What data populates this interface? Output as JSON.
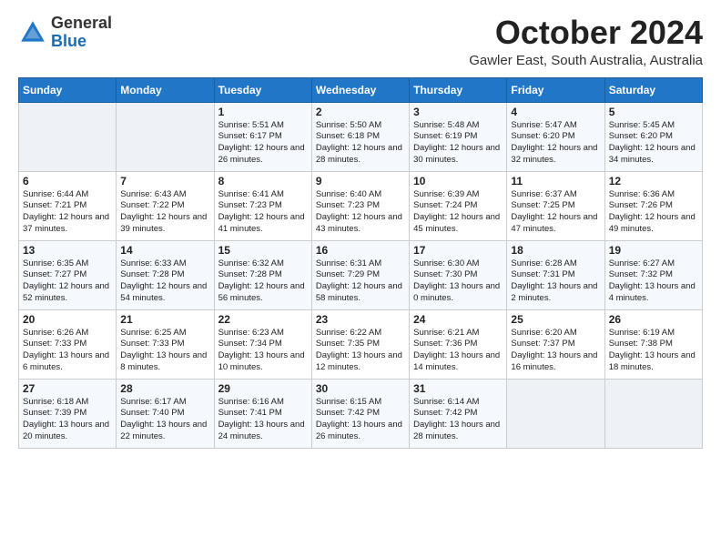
{
  "logo": {
    "general": "General",
    "blue": "Blue"
  },
  "header": {
    "month": "October 2024",
    "location": "Gawler East, South Australia, Australia"
  },
  "days_of_week": [
    "Sunday",
    "Monday",
    "Tuesday",
    "Wednesday",
    "Thursday",
    "Friday",
    "Saturday"
  ],
  "weeks": [
    [
      {
        "day": null
      },
      {
        "day": null
      },
      {
        "day": 1,
        "sunrise": "Sunrise: 5:51 AM",
        "sunset": "Sunset: 6:17 PM",
        "daylight": "Daylight: 12 hours and 26 minutes."
      },
      {
        "day": 2,
        "sunrise": "Sunrise: 5:50 AM",
        "sunset": "Sunset: 6:18 PM",
        "daylight": "Daylight: 12 hours and 28 minutes."
      },
      {
        "day": 3,
        "sunrise": "Sunrise: 5:48 AM",
        "sunset": "Sunset: 6:19 PM",
        "daylight": "Daylight: 12 hours and 30 minutes."
      },
      {
        "day": 4,
        "sunrise": "Sunrise: 5:47 AM",
        "sunset": "Sunset: 6:20 PM",
        "daylight": "Daylight: 12 hours and 32 minutes."
      },
      {
        "day": 5,
        "sunrise": "Sunrise: 5:45 AM",
        "sunset": "Sunset: 6:20 PM",
        "daylight": "Daylight: 12 hours and 34 minutes."
      }
    ],
    [
      {
        "day": 6,
        "sunrise": "Sunrise: 6:44 AM",
        "sunset": "Sunset: 7:21 PM",
        "daylight": "Daylight: 12 hours and 37 minutes."
      },
      {
        "day": 7,
        "sunrise": "Sunrise: 6:43 AM",
        "sunset": "Sunset: 7:22 PM",
        "daylight": "Daylight: 12 hours and 39 minutes."
      },
      {
        "day": 8,
        "sunrise": "Sunrise: 6:41 AM",
        "sunset": "Sunset: 7:23 PM",
        "daylight": "Daylight: 12 hours and 41 minutes."
      },
      {
        "day": 9,
        "sunrise": "Sunrise: 6:40 AM",
        "sunset": "Sunset: 7:23 PM",
        "daylight": "Daylight: 12 hours and 43 minutes."
      },
      {
        "day": 10,
        "sunrise": "Sunrise: 6:39 AM",
        "sunset": "Sunset: 7:24 PM",
        "daylight": "Daylight: 12 hours and 45 minutes."
      },
      {
        "day": 11,
        "sunrise": "Sunrise: 6:37 AM",
        "sunset": "Sunset: 7:25 PM",
        "daylight": "Daylight: 12 hours and 47 minutes."
      },
      {
        "day": 12,
        "sunrise": "Sunrise: 6:36 AM",
        "sunset": "Sunset: 7:26 PM",
        "daylight": "Daylight: 12 hours and 49 minutes."
      }
    ],
    [
      {
        "day": 13,
        "sunrise": "Sunrise: 6:35 AM",
        "sunset": "Sunset: 7:27 PM",
        "daylight": "Daylight: 12 hours and 52 minutes."
      },
      {
        "day": 14,
        "sunrise": "Sunrise: 6:33 AM",
        "sunset": "Sunset: 7:28 PM",
        "daylight": "Daylight: 12 hours and 54 minutes."
      },
      {
        "day": 15,
        "sunrise": "Sunrise: 6:32 AM",
        "sunset": "Sunset: 7:28 PM",
        "daylight": "Daylight: 12 hours and 56 minutes."
      },
      {
        "day": 16,
        "sunrise": "Sunrise: 6:31 AM",
        "sunset": "Sunset: 7:29 PM",
        "daylight": "Daylight: 12 hours and 58 minutes."
      },
      {
        "day": 17,
        "sunrise": "Sunrise: 6:30 AM",
        "sunset": "Sunset: 7:30 PM",
        "daylight": "Daylight: 13 hours and 0 minutes."
      },
      {
        "day": 18,
        "sunrise": "Sunrise: 6:28 AM",
        "sunset": "Sunset: 7:31 PM",
        "daylight": "Daylight: 13 hours and 2 minutes."
      },
      {
        "day": 19,
        "sunrise": "Sunrise: 6:27 AM",
        "sunset": "Sunset: 7:32 PM",
        "daylight": "Daylight: 13 hours and 4 minutes."
      }
    ],
    [
      {
        "day": 20,
        "sunrise": "Sunrise: 6:26 AM",
        "sunset": "Sunset: 7:33 PM",
        "daylight": "Daylight: 13 hours and 6 minutes."
      },
      {
        "day": 21,
        "sunrise": "Sunrise: 6:25 AM",
        "sunset": "Sunset: 7:33 PM",
        "daylight": "Daylight: 13 hours and 8 minutes."
      },
      {
        "day": 22,
        "sunrise": "Sunrise: 6:23 AM",
        "sunset": "Sunset: 7:34 PM",
        "daylight": "Daylight: 13 hours and 10 minutes."
      },
      {
        "day": 23,
        "sunrise": "Sunrise: 6:22 AM",
        "sunset": "Sunset: 7:35 PM",
        "daylight": "Daylight: 13 hours and 12 minutes."
      },
      {
        "day": 24,
        "sunrise": "Sunrise: 6:21 AM",
        "sunset": "Sunset: 7:36 PM",
        "daylight": "Daylight: 13 hours and 14 minutes."
      },
      {
        "day": 25,
        "sunrise": "Sunrise: 6:20 AM",
        "sunset": "Sunset: 7:37 PM",
        "daylight": "Daylight: 13 hours and 16 minutes."
      },
      {
        "day": 26,
        "sunrise": "Sunrise: 6:19 AM",
        "sunset": "Sunset: 7:38 PM",
        "daylight": "Daylight: 13 hours and 18 minutes."
      }
    ],
    [
      {
        "day": 27,
        "sunrise": "Sunrise: 6:18 AM",
        "sunset": "Sunset: 7:39 PM",
        "daylight": "Daylight: 13 hours and 20 minutes."
      },
      {
        "day": 28,
        "sunrise": "Sunrise: 6:17 AM",
        "sunset": "Sunset: 7:40 PM",
        "daylight": "Daylight: 13 hours and 22 minutes."
      },
      {
        "day": 29,
        "sunrise": "Sunrise: 6:16 AM",
        "sunset": "Sunset: 7:41 PM",
        "daylight": "Daylight: 13 hours and 24 minutes."
      },
      {
        "day": 30,
        "sunrise": "Sunrise: 6:15 AM",
        "sunset": "Sunset: 7:42 PM",
        "daylight": "Daylight: 13 hours and 26 minutes."
      },
      {
        "day": 31,
        "sunrise": "Sunrise: 6:14 AM",
        "sunset": "Sunset: 7:42 PM",
        "daylight": "Daylight: 13 hours and 28 minutes."
      },
      {
        "day": null
      },
      {
        "day": null
      }
    ]
  ]
}
